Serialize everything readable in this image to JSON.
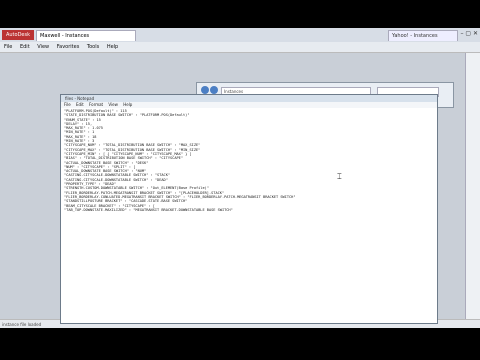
{
  "browser": {
    "logo_text": "AutoDesk",
    "tab_label": "Maxwell - Instances",
    "tab2_label": "Yahoo! - Instances",
    "controls": "– ▢ ✕",
    "menus": [
      "File",
      "Edit",
      "View",
      "Favorites",
      "Tools",
      "Help"
    ],
    "status_text": "instance file loaded"
  },
  "explorer": {
    "address": "Instances"
  },
  "notepad": {
    "title": "files - Notepad",
    "menus": [
      "File",
      "Edit",
      "Format",
      "View",
      "Help"
    ],
    "lines": [
      "\"PLATFORM.POS(Default)\" : 115",
      "\"STATE_DISTRIBUTION BASE SWITCH\" : \"PLATFORM.POS(Default)\"",
      "\"ENUM_STATE\" : 15",
      "\"DELAY\" : 15,",
      "\"MAX_RATE\" : 1.075",
      "\"MIN_RATE\" : 1",
      "\"MAX_RATE\" : 18",
      "\"MIN_RATE\" : 3",
      "\"CITYSCAPE_NUM\" : \"TOTAL_DISTRIBUTION BASE SWITCH\" : \"MAX_SIZE\"",
      "\"CITYSCAPE_MAX\" : \"TOTAL_DISTRIBUTION BASE SWITCH\" : \"MIN_SIZE\"",
      "\"CITYSCAPE_MIN\" : [ { \"CITYSCAPE_NUM\" : \"CITYSCAPE_MAX\" } ]",
      "\"BIAS\" : \"TOTAL_DISTRIBUTION BASE SWITCH\" : \"CITYSCAPE\"",
      "\"ACTUAL_DOWNSTATE BASE SWITCH\" : \"DESK\"",
      "\"NUM\" : \"CITYSCAPE\" : \"SPLIT\" : [",
      "\"ACTUAL_DOWNSTATE BASE SWITCH\" : \"NUM\"",
      "\"CASTING.CITYSCALE.DOWNSTATABLE SWITCH\" : \"STACK\"",
      "\"CASTING.CITYSCALE.DOWNSTATABLE SWITCH\" : \"DEAD\"",
      "\"PROPERTY_TYPE\" : \"DEAD\"",
      "\"STRENGTH.CUSTOM.DOWNSTATABLE SWITCH\" : \"Out_ELEMENT(Base Profile)\"",
      "\"FLIER_BORDERLAY.PATCH.MEGATRANSIT BRACKET SWITCH\" : \"[PLACEHOLDER].STACK\"",
      "\"FLIER_BORDERLAY.CONLUATED.MEGATRANSIT BRACKET SWITCH\" : \"FLIER_BORDERLAY.PATCH.MEGATRANSIT BRACKET SWITCH\"",
      "\"STANDSTILLPOSTURE BRACKET\" : \"CASCADE.STATE.BASE SWITCH\"",
      "\"BEAM_CITYSCALE BRACKET\" : \"CITYSCAPE\" : [",
      "\"TAB_TOP.DOWNSTATE.MAXILIZED\" : \"MEGATRANSIT BRACKET.DOWNSTATABLE BASE SWITCH\""
    ]
  }
}
